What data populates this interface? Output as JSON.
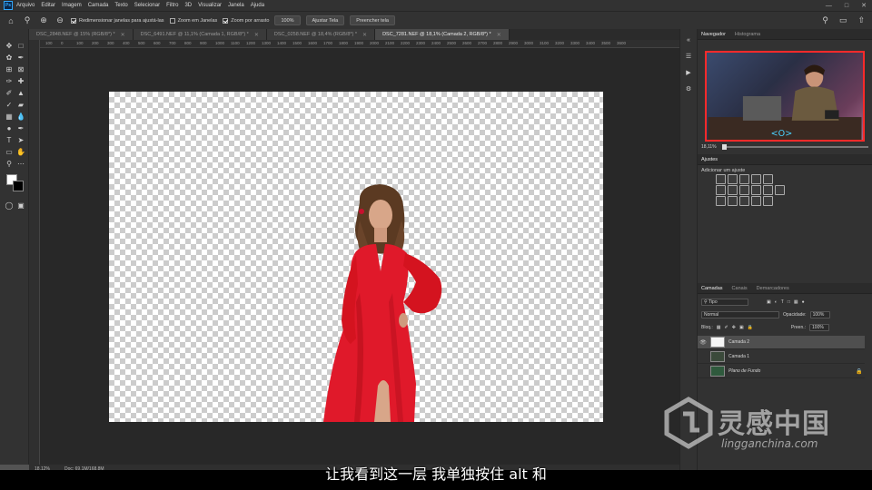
{
  "app": {
    "logo_text": "Ps"
  },
  "menu": [
    "Arquivo",
    "Editar",
    "Imagem",
    "Camada",
    "Texto",
    "Selecionar",
    "Filtro",
    "3D",
    "Visualizar",
    "Janela",
    "Ajuda"
  ],
  "options": {
    "resize_windows": "Redimensionar janelas para ajustá-las",
    "zoom_all_windows": "Zoom em Janelas",
    "scrubby_zoom": "Zoom por arrasto",
    "zoom_percent": "100%",
    "fit_screen": "Ajustar Tela",
    "fill_screen": "Preencher tela"
  },
  "tabs": [
    {
      "label": "DSC_2848.NEF @ 15% (RGB/8*) *",
      "active": false
    },
    {
      "label": "DSC_6491.NEF @ 11,1% (Camada 1, RGB/8*) *",
      "active": false
    },
    {
      "label": "DSC_0258.NEF @ 18,4% (RGB/8*) *",
      "active": false
    },
    {
      "label": "DSC_7281.NEF @ 18,1% (Camada 2, RGB/8*) *",
      "active": true
    }
  ],
  "ruler_ticks": [
    "100",
    "0",
    "100",
    "200",
    "300",
    "400",
    "500",
    "600",
    "700",
    "800",
    "900",
    "1000",
    "1100",
    "1200",
    "1300",
    "1400",
    "1500",
    "1600",
    "1700",
    "1800",
    "1900",
    "2000",
    "2100",
    "2200",
    "2300",
    "2400",
    "2500",
    "2600",
    "2700",
    "2800",
    "2900",
    "3000",
    "3100",
    "3200",
    "3300",
    "3400",
    "3500",
    "3600"
  ],
  "status": {
    "zoom": "18,12%",
    "doc": "Doc: 69,1M/168,8M"
  },
  "navigator": {
    "tab": "Navegador",
    "tab2": "Histograma",
    "zoom": "18,11%"
  },
  "adjustments": {
    "tab": "Ajustes",
    "subtitle": "Adicionar um ajuste"
  },
  "layers_panel": {
    "tabs": [
      "Camadas",
      "Canais",
      "Demarcadores"
    ],
    "filter": "Tipo",
    "blend_mode": "Normal",
    "opacity_label": "Opacidade:",
    "opacity_value": "100%",
    "lock_label": "Bloq.:",
    "fill_label": "Preen.:",
    "fill_value": "100%",
    "layers": [
      {
        "name": "Camada 2",
        "visible": true,
        "selected": true,
        "locked": false
      },
      {
        "name": "Camada 1",
        "visible": false,
        "selected": false,
        "locked": false
      },
      {
        "name": "Plano de Fundo",
        "visible": false,
        "selected": false,
        "locked": true
      }
    ]
  },
  "subtitle": "让我看到这一层 我单独按住 alt 和",
  "watermark": {
    "cn": "灵感中国",
    "en": "lingganchina.com"
  },
  "colors": {
    "accent": "#31a8ff",
    "dress": "#e0192a",
    "nav_border": "#ff2a2a"
  }
}
